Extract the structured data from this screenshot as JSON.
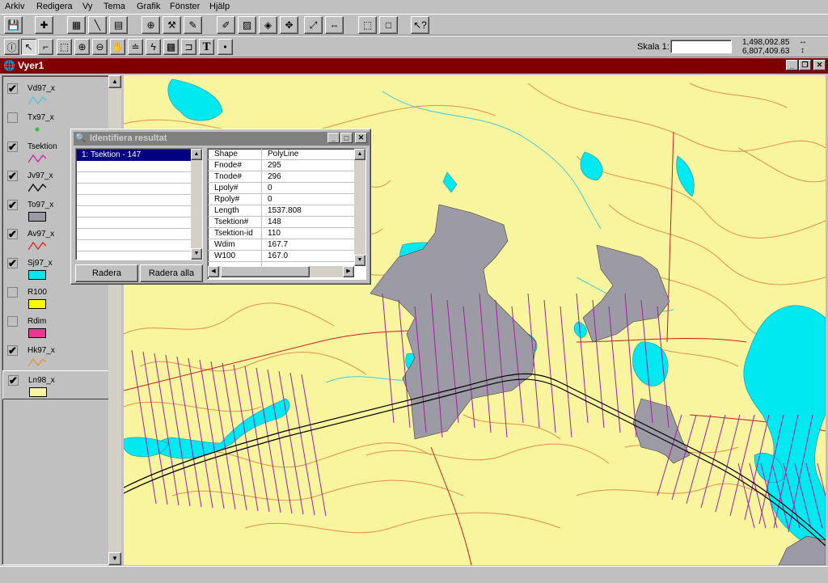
{
  "menu": [
    "Arkiv",
    "Redigera",
    "Vy",
    "Tema",
    "Grafik",
    "Fönster",
    "Hjälp"
  ],
  "scale": {
    "label": "Skala 1:",
    "value": ""
  },
  "coords": {
    "x": "1,498,092.85",
    "y": "6,807,409.63",
    "x_arrow": "↔",
    "y_arrow": "↕"
  },
  "view": {
    "title": "Vyer1"
  },
  "toc": {
    "layers": [
      {
        "name": "Vd97_x",
        "checked": true,
        "symbol": "line",
        "color": "#49c8d8"
      },
      {
        "name": "Tx97_x",
        "checked": false,
        "symbol": "point",
        "color": "#30c030"
      },
      {
        "name": "Tsektion",
        "checked": true,
        "symbol": "line",
        "color": "#d020a0"
      },
      {
        "name": "Jv97_x",
        "checked": true,
        "symbol": "line",
        "color": "#000000"
      },
      {
        "name": "To97_x",
        "checked": true,
        "symbol": "fill",
        "color": "#9c9aa4"
      },
      {
        "name": "Av97_x",
        "checked": true,
        "symbol": "line",
        "color": "#e02020"
      },
      {
        "name": "Sj97_x",
        "checked": true,
        "symbol": "fill",
        "color": "#00e8f0"
      },
      {
        "name": "R100",
        "checked": false,
        "symbol": "fill",
        "color": "#f8f800"
      },
      {
        "name": "Rdim",
        "checked": false,
        "symbol": "fill",
        "color": "#e83890"
      },
      {
        "name": "Hk97_x",
        "checked": true,
        "symbol": "line",
        "color": "#e09048"
      },
      {
        "name": "Ln98_x",
        "checked": true,
        "symbol": "fill",
        "color": "#f8f59e"
      }
    ]
  },
  "dialog": {
    "title": "Identifiera resultat",
    "results": [
      "1:  Tsektion - 147"
    ],
    "attributes": [
      {
        "field": "Shape",
        "value": "PolyLine"
      },
      {
        "field": "Fnode#",
        "value": "295"
      },
      {
        "field": "Tnode#",
        "value": "296"
      },
      {
        "field": "Lpoly#",
        "value": "0"
      },
      {
        "field": "Rpoly#",
        "value": "0"
      },
      {
        "field": "Length",
        "value": "1537.808"
      },
      {
        "field": "Tsektion#",
        "value": "148"
      },
      {
        "field": "Tsektion-id",
        "value": "110"
      },
      {
        "field": "Wdim",
        "value": "167.7"
      },
      {
        "field": "W100",
        "value": "167.0"
      }
    ],
    "buttons": {
      "delete": "Radera",
      "delete_all": "Radera alla"
    }
  },
  "colors": {
    "land": "#f8f59e",
    "water": "#00e8f0",
    "urban": "#9c9aa4",
    "section": "#a020a0",
    "road": "#c02020",
    "contour": "#e09048",
    "stream": "#49c8d8",
    "rail": "#000000",
    "titlebar": "#800000"
  },
  "toolbar1": [
    "save-icon",
    "add-theme-icon",
    "table-icon",
    "link-icon",
    "chart-icon",
    "binoculars-icon",
    "hammer-icon",
    "pencil-icon",
    "edit-icon",
    "layout-icon",
    "theme-props-icon",
    "query-icon",
    "zoom-full-icon",
    "zoom-active-icon",
    "zoom-select-icon",
    "select-all-icon",
    "clear-select-icon",
    "help-icon"
  ],
  "toolbar2": [
    "info-icon",
    "pointer-icon",
    "vertex-icon",
    "select-box-icon",
    "zoom-in-icon",
    "zoom-out-icon",
    "pan-icon",
    "measure-icon",
    "hotlink-icon",
    "area-icon",
    "label-icon",
    "text-icon",
    "draw-point-icon"
  ]
}
